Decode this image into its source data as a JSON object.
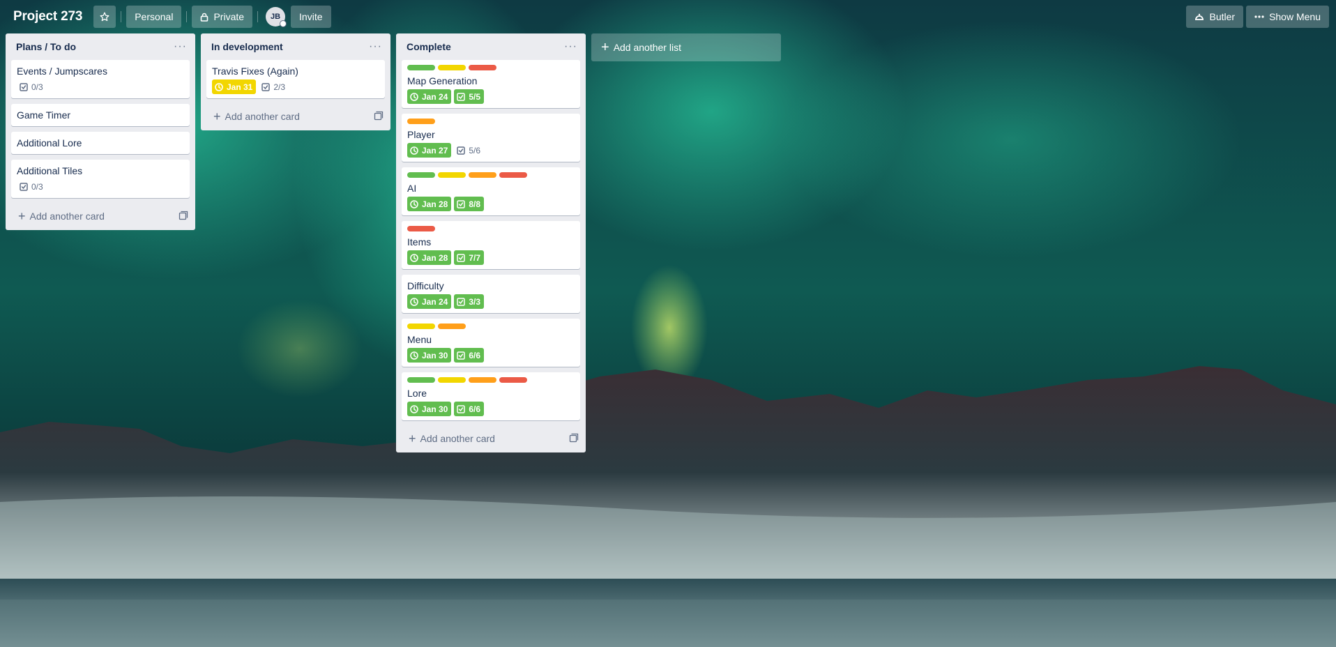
{
  "header": {
    "title": "Project 273",
    "star_icon": "star-icon",
    "team_label": "Personal",
    "visibility_label": "Private",
    "avatar_initials": "JB",
    "invite_label": "Invite",
    "butler_label": "Butler",
    "show_menu_label": "Show Menu"
  },
  "colors": {
    "green": "#61bd4f",
    "yellow": "#f2d600",
    "orange": "#ff9f1a",
    "red": "#eb5a46"
  },
  "lists": [
    {
      "title": "Plans / To do",
      "add_card_label": "Add another card",
      "cards": [
        {
          "title": "Events / Jumpscares",
          "checklist": "0/3"
        },
        {
          "title": "Game Timer"
        },
        {
          "title": "Additional Lore"
        },
        {
          "title": "Additional Tiles",
          "checklist": "0/3"
        }
      ]
    },
    {
      "title": "In development",
      "add_card_label": "Add another card",
      "cards": [
        {
          "title": "Travis Fixes (Again)",
          "due": "Jan 31",
          "due_status": "yellow",
          "checklist": "2/3"
        }
      ]
    },
    {
      "title": "Complete",
      "add_card_label": "Add another card",
      "cards": [
        {
          "title": "Map Generation",
          "labels": [
            "green",
            "yellow",
            "red"
          ],
          "due": "Jan 24",
          "due_status": "green",
          "checklist": "5/5",
          "checklist_complete": true
        },
        {
          "title": "Player",
          "labels": [
            "orange"
          ],
          "due": "Jan 27",
          "due_status": "green",
          "checklist": "5/6",
          "checklist_complete": false
        },
        {
          "title": "AI",
          "labels": [
            "green",
            "yellow",
            "orange",
            "red"
          ],
          "due": "Jan 28",
          "due_status": "green",
          "checklist": "8/8",
          "checklist_complete": true
        },
        {
          "title": "Items",
          "labels": [
            "red"
          ],
          "due": "Jan 28",
          "due_status": "green",
          "checklist": "7/7",
          "checklist_complete": true
        },
        {
          "title": "Difficulty",
          "labels": [],
          "due": "Jan 24",
          "due_status": "green",
          "checklist": "3/3",
          "checklist_complete": true
        },
        {
          "title": "Menu",
          "labels": [
            "yellow",
            "orange"
          ],
          "due": "Jan 30",
          "due_status": "green",
          "checklist": "6/6",
          "checklist_complete": true
        },
        {
          "title": "Lore",
          "labels": [
            "green",
            "yellow",
            "orange",
            "red"
          ],
          "due": "Jan 30",
          "due_status": "green",
          "checklist": "6/6",
          "checklist_complete": true
        }
      ]
    }
  ],
  "add_list_label": "Add another list"
}
